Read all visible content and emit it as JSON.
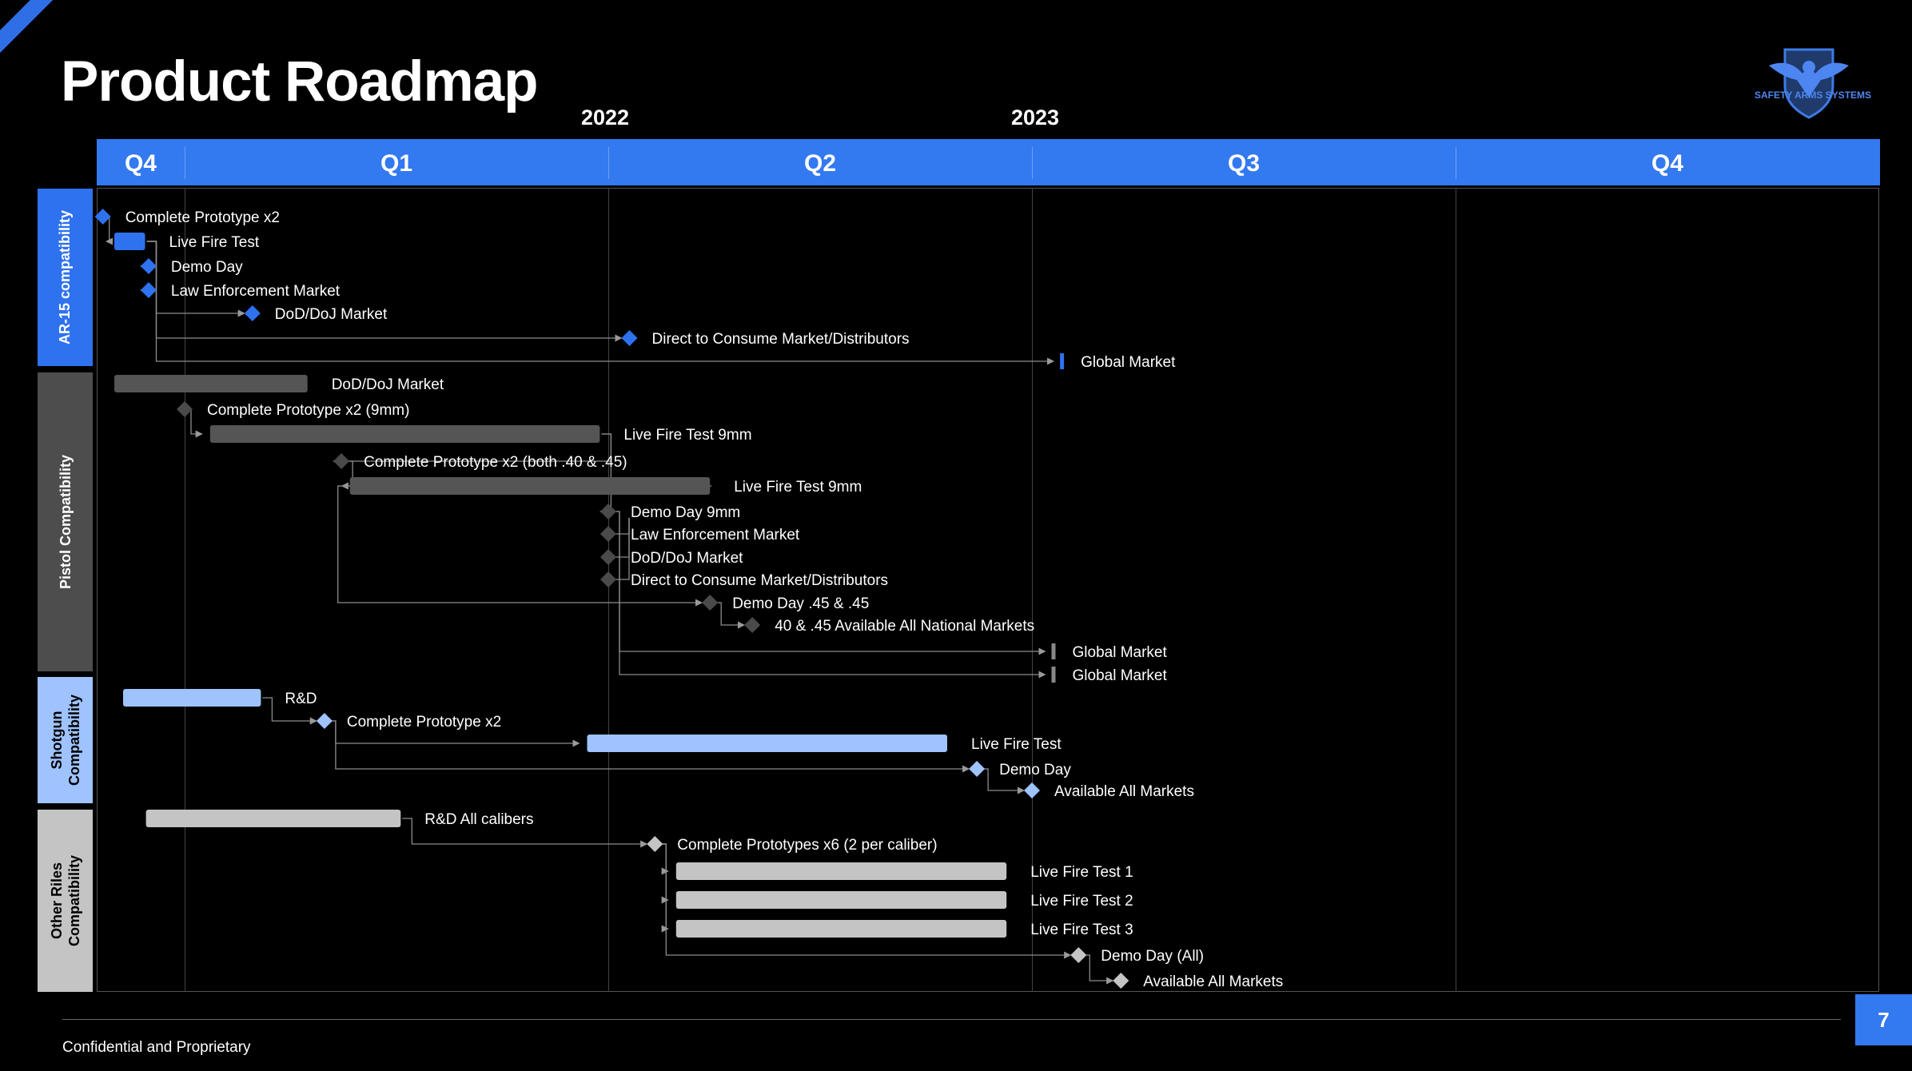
{
  "title": "Product Roadmap",
  "page_number": "7",
  "footer": "Confidential and Proprietary",
  "logo": {
    "icon": "eagle-shield-icon",
    "text": "SAFETY ARMS SYSTEMS"
  },
  "colors": {
    "accent": "#3379f0",
    "ar15": "#2f72f0",
    "pistol": "#4d4d4d",
    "shotgun": "#9ec3ff",
    "other": "#c4c4c4",
    "connector": "#8c8c8c"
  },
  "timeline": {
    "years": [
      "2022",
      "2023"
    ],
    "quarters": [
      "Q4",
      "Q1",
      "Q2",
      "Q3",
      "Q4"
    ]
  },
  "lanes": [
    {
      "id": "ar15",
      "label": "AR-15 compatibility"
    },
    {
      "id": "pistol",
      "label": "Pistol Compatibility"
    },
    {
      "id": "shotgun",
      "label": "Shotgun Compatibility"
    },
    {
      "id": "other",
      "label": "Other Riles Compatibility"
    }
  ],
  "chart_data": {
    "type": "gantt",
    "tasks": [
      {
        "lane": "ar15",
        "label": "Complete Prototype x2",
        "kind": "milestone",
        "start": 0.07
      },
      {
        "lane": "ar15",
        "label": "Live Fire Test",
        "kind": "bar",
        "start": 0.2,
        "end": 0.55
      },
      {
        "lane": "ar15",
        "label": "Demo Day",
        "kind": "milestone",
        "start": 0.59
      },
      {
        "lane": "ar15",
        "label": "Law Enforcement Market",
        "kind": "milestone",
        "start": 0.59
      },
      {
        "lane": "ar15",
        "label": "DoD/DoJ Market",
        "kind": "milestone",
        "start": 1.16
      },
      {
        "lane": "ar15",
        "label": "Direct to Consume Market/Distributors",
        "kind": "milestone",
        "start": 2.05
      },
      {
        "lane": "ar15",
        "label": "Global Market",
        "kind": "marker",
        "start": 3.07
      },
      {
        "lane": "pistol",
        "label": "DoD/DoJ Market",
        "kind": "bar",
        "start": 0.2,
        "end": 1.29
      },
      {
        "lane": "pistol",
        "label": "Complete Prototype x2 (9mm)",
        "kind": "milestone",
        "start": 1.0
      },
      {
        "lane": "pistol",
        "label": "Live Fire Test 9mm",
        "kind": "bar",
        "start": 1.06,
        "end": 1.98
      },
      {
        "lane": "pistol",
        "label": "Complete Prototype x2 (both .40 & .45)",
        "kind": "milestone",
        "start": 1.37
      },
      {
        "lane": "pistol",
        "label": "Live Fire Test 9mm",
        "kind": "bar",
        "start": 1.39,
        "end": 2.24
      },
      {
        "lane": "pistol",
        "label": "Demo Day 9mm",
        "kind": "milestone",
        "start": 2.0
      },
      {
        "lane": "pistol",
        "label": "Law Enforcement Market",
        "kind": "milestone",
        "start": 2.0
      },
      {
        "lane": "pistol",
        "label": "DoD/DoJ Market",
        "kind": "milestone",
        "start": 2.0
      },
      {
        "lane": "pistol",
        "label": "Direct to Consume Market/Distributors",
        "kind": "milestone",
        "start": 2.0
      },
      {
        "lane": "pistol",
        "label": "Demo Day .45 & .45",
        "kind": "milestone",
        "start": 2.24
      },
      {
        "lane": "pistol",
        "label": "40 & .45 Available All National Markets",
        "kind": "milestone",
        "start": 2.34
      },
      {
        "lane": "pistol",
        "label": "Global Market",
        "kind": "marker",
        "start": 3.05
      },
      {
        "lane": "pistol",
        "label": "Global Market",
        "kind": "marker",
        "start": 3.05
      },
      {
        "lane": "shotgun",
        "label": "R&D",
        "kind": "bar",
        "start": 0.3,
        "end": 1.18
      },
      {
        "lane": "shotgun",
        "label": "Complete Prototype x2",
        "kind": "milestone",
        "start": 1.33
      },
      {
        "lane": "shotgun",
        "label": "Live Fire Test",
        "kind": "bar",
        "start": 1.95,
        "end": 2.8
      },
      {
        "lane": "shotgun",
        "label": "Demo Day",
        "kind": "milestone",
        "start": 2.87
      },
      {
        "lane": "shotgun",
        "label": "Available All Markets",
        "kind": "milestone",
        "start": 3.0
      },
      {
        "lane": "other",
        "label": "R&D All calibers",
        "kind": "bar",
        "start": 0.56,
        "end": 1.51
      },
      {
        "lane": "other",
        "label": "Complete Prototypes x6 (2 per caliber)",
        "kind": "milestone",
        "start": 2.11
      },
      {
        "lane": "other",
        "label": "Live Fire Test  1",
        "kind": "bar",
        "start": 2.16,
        "end": 2.94
      },
      {
        "lane": "other",
        "label": "Live Fire Test  2",
        "kind": "bar",
        "start": 2.16,
        "end": 2.94
      },
      {
        "lane": "other",
        "label": "Live Fire Test  3",
        "kind": "bar",
        "start": 2.16,
        "end": 2.94
      },
      {
        "lane": "other",
        "label": "Demo Day (All)",
        "kind": "milestone",
        "start": 3.11
      },
      {
        "lane": "other",
        "label": "Available All Markets",
        "kind": "milestone",
        "start": 3.21
      }
    ]
  }
}
